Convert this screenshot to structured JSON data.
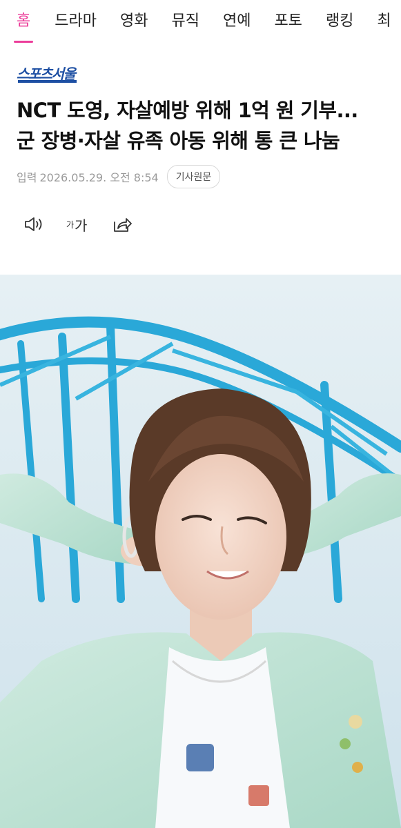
{
  "nav": {
    "tabs": [
      {
        "label": "홈",
        "active": true
      },
      {
        "label": "드라마",
        "active": false
      },
      {
        "label": "영화",
        "active": false
      },
      {
        "label": "뮤직",
        "active": false
      },
      {
        "label": "연예",
        "active": false
      },
      {
        "label": "포토",
        "active": false
      },
      {
        "label": "랭킹",
        "active": false
      },
      {
        "label": "최",
        "active": false
      }
    ],
    "accent_color": "#ec3d9a"
  },
  "article": {
    "source_logo": "스포츠서울",
    "source_logo_color": "#1d4fa3",
    "headline_line1": "NCT 도영, 자살예방 위해 1억 원 기부...",
    "headline_line2": "군 장병·자살 유족 아동 위해 통 큰 나눔",
    "date_label": "입력",
    "date": "2026.05.29. 오전 8:54",
    "original_button": "기사원문"
  },
  "toolbar": {
    "font_size_small": "가",
    "font_size_large": "가",
    "icons": [
      "speaker-icon",
      "font-size-icon",
      "share-icon"
    ]
  },
  "image": {
    "description_icon": "article-photo"
  }
}
